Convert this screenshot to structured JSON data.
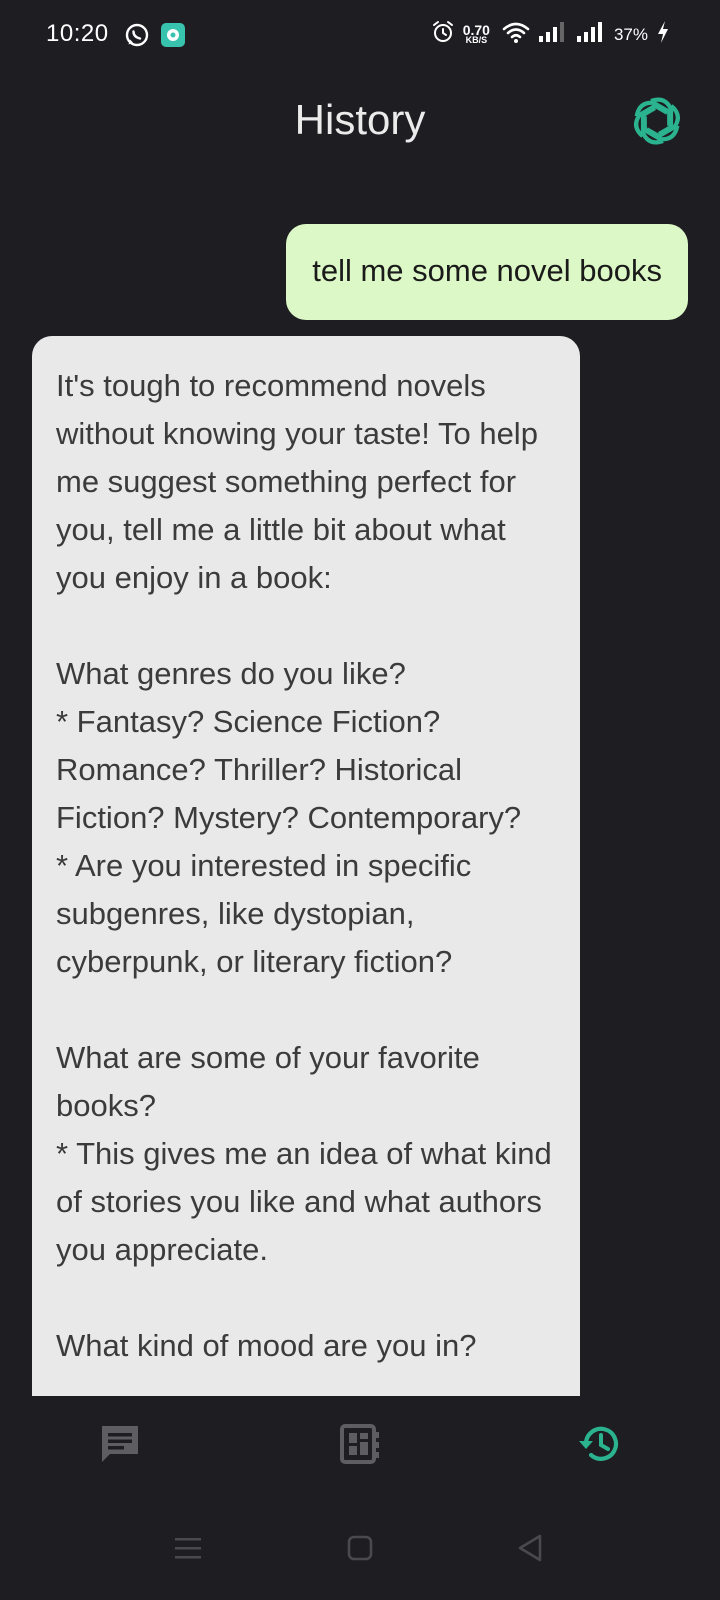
{
  "status_bar": {
    "time": "10:20",
    "net_speed_value": "0.70",
    "net_speed_unit": "KB/S",
    "battery_percent": "37%"
  },
  "header": {
    "title": "History",
    "logo_icon": "openai-logo-icon",
    "accent_color": "#2bb38f"
  },
  "chat": {
    "messages": [
      {
        "role": "user",
        "text": "tell me some novel books"
      },
      {
        "role": "assistant",
        "text": "It's tough to recommend novels without knowing your taste! To help me suggest something perfect for you, tell me a little bit about what you enjoy in a book:\n\nWhat genres do you like?\n* Fantasy? Science Fiction? Romance? Thriller? Historical Fiction? Mystery? Contemporary?\n* Are you interested in specific subgenres, like dystopian, cyberpunk, or literary fiction?\n\nWhat are some of your favorite books?\n* This gives me an idea of what kind of stories you like and what authors you appreciate.\n\nWhat kind of mood are you in?"
      }
    ]
  },
  "bottom_nav": {
    "items": [
      {
        "icon": "chat-icon",
        "active": false
      },
      {
        "icon": "dashboard-icon",
        "active": false
      },
      {
        "icon": "history-icon",
        "active": true
      }
    ]
  },
  "system_nav": {
    "items": [
      "menu-icon",
      "home-icon",
      "back-icon"
    ]
  }
}
